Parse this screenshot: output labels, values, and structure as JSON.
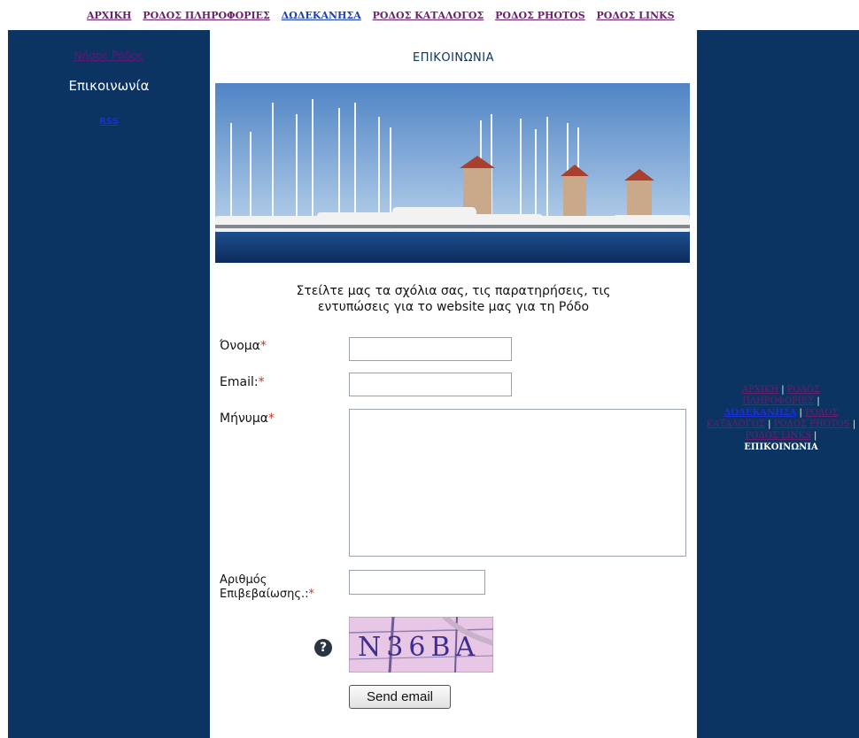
{
  "topnav": {
    "items": [
      {
        "label": "ΑΡΧΙΚΗ"
      },
      {
        "label": "ΡΟΔΟΣ ΠΛΗΡΟΦΟΡΙΕΣ"
      },
      {
        "label": "ΔΩΔΕΚΑΝΗΣΑ"
      },
      {
        "label": "ΡΟΔΟΣ ΚΑΤΑΛΟΓΟΣ"
      },
      {
        "label": "ΡΟΔΟΣ PHOTOS"
      },
      {
        "label": "ΡΟΔΟΣ LINKS"
      }
    ]
  },
  "leftcol": {
    "link1": "Νήσος Ρόδος",
    "title": "Επικοινωνία",
    "link2": "RSS"
  },
  "main": {
    "title": "ΕΠΙΚΟΙΝΩΝΙΑ",
    "intro_line1": "Στείλτε μας τα σχόλια σας, τις παρατηρήσεις, τις",
    "intro_line2": "εντυπώσεις για το website μας για τη Ρόδο",
    "form": {
      "name_label": "Όνομα",
      "email_label": "Email:",
      "message_label": "Μήνυμα",
      "confirm_label_1": "Αριθμός",
      "confirm_label_2": "Επιβεβαίωσης.:",
      "required_mark": "*",
      "name_value": "",
      "email_value": "",
      "message_value": "",
      "confirm_value": "",
      "captcha_text": "N36BA",
      "help_glyph": "?",
      "send_label": "Send email"
    }
  },
  "rightnav": {
    "items": [
      {
        "label": "ΑΡΧΙΚΗ"
      },
      {
        "label": "ΡΟΔΟΣ ΠΛΗΡΟΦΟΡΙΕΣ"
      },
      {
        "label": "ΔΩΔΕΚΑΝΗΣΑ"
      },
      {
        "label": "ΡΟΔΟΣ ΚΑΤΑΛΟΓΟΣ"
      },
      {
        "label": "ΡΟΔΟΣ PHOTOS"
      },
      {
        "label": "ΡΟΔΟΣ LINKS"
      }
    ],
    "separator": " | ",
    "current": "ΕΠΙΚΟΙΝΩΝΙΑ"
  },
  "colors": {
    "column_bg": "#0b3463",
    "link_visited": "#6a1f6a",
    "link_active": "#1d2fd0",
    "required": "#c0392b"
  }
}
